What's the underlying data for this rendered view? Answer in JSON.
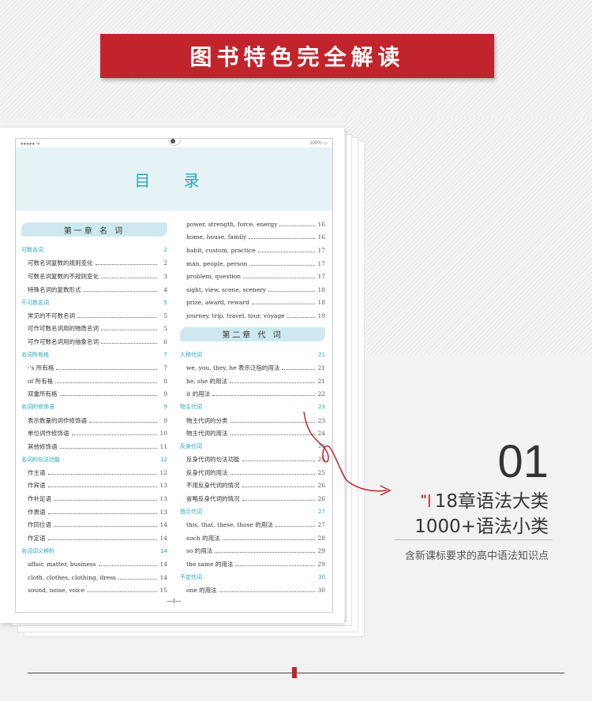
{
  "banner": {
    "title": "图书特色完全解读"
  },
  "tablet": {
    "status_left": "●●●●● ᯤ",
    "status_right": "100% ▭",
    "toc_title": "目 录",
    "page_number": "—I—",
    "left_column": {
      "chapter": "第一章 名 词",
      "rows": [
        {
          "type": "section",
          "label": "可数名词",
          "page": "2"
        },
        {
          "type": "item",
          "label": "可数名词复数的规则变化",
          "page": "2"
        },
        {
          "type": "item",
          "label": "可数名词复数的不规则变化",
          "page": "3"
        },
        {
          "type": "item",
          "label": "特殊名词的复数形式",
          "page": "4"
        },
        {
          "type": "section",
          "label": "不可数名词",
          "page": "5"
        },
        {
          "type": "item",
          "label": "常见的不可数名词",
          "page": "5"
        },
        {
          "type": "item",
          "label": "可作可数名词用的物质名词",
          "page": "5"
        },
        {
          "type": "item",
          "label": "可作可数名词用的抽象名词",
          "page": "6"
        },
        {
          "type": "section",
          "label": "名词所有格",
          "page": "7"
        },
        {
          "type": "item",
          "label": "-'s 所有格",
          "page": "7"
        },
        {
          "type": "item",
          "label": "of 所有格",
          "page": "8"
        },
        {
          "type": "item",
          "label": "双重所有格",
          "page": "9"
        },
        {
          "type": "section",
          "label": "名词的修饰语",
          "page": "9"
        },
        {
          "type": "item",
          "label": "表示数量的词作修饰语",
          "page": "9"
        },
        {
          "type": "item",
          "label": "单位词作修饰语",
          "page": "10"
        },
        {
          "type": "item",
          "label": "其他修饰语",
          "page": "11"
        },
        {
          "type": "section",
          "label": "名词的句法功能",
          "page": "12"
        },
        {
          "type": "item",
          "label": "作主语",
          "page": "12"
        },
        {
          "type": "item",
          "label": "作宾语",
          "page": "13"
        },
        {
          "type": "item",
          "label": "作补足语",
          "page": "13"
        },
        {
          "type": "item",
          "label": "作表语",
          "page": "13"
        },
        {
          "type": "item",
          "label": "作同位语",
          "page": "14"
        },
        {
          "type": "item",
          "label": "作定语",
          "page": "14"
        },
        {
          "type": "section",
          "label": "名词词义辨析",
          "page": "14"
        },
        {
          "type": "item",
          "label": "affair, matter, business",
          "page": "14"
        },
        {
          "type": "item",
          "label": "cloth, clothes, clothing, dress",
          "page": "14"
        },
        {
          "type": "item",
          "label": "sound, noise, voice",
          "page": "15"
        }
      ]
    },
    "right_column": {
      "rows_before": [
        {
          "type": "item",
          "label": "power, strength, force, energy",
          "page": "16"
        },
        {
          "type": "item",
          "label": "home, house, family",
          "page": "16"
        },
        {
          "type": "item",
          "label": "habit, custom, practice",
          "page": "17"
        },
        {
          "type": "item",
          "label": "man, people, person",
          "page": "17"
        },
        {
          "type": "item",
          "label": "problem, question",
          "page": "17"
        },
        {
          "type": "item",
          "label": "sight, view, scene, scenery",
          "page": "18"
        },
        {
          "type": "item",
          "label": "prize, award, reward",
          "page": "18"
        },
        {
          "type": "item",
          "label": "journey, trip, travel, tour, voyage",
          "page": "19"
        }
      ],
      "chapter": "第二章 代 词",
      "rows": [
        {
          "type": "section",
          "label": "人称代词",
          "page": "21"
        },
        {
          "type": "item",
          "label": "we, you, they, he 表示泛指的用法",
          "page": "21"
        },
        {
          "type": "item",
          "label": "he, she 的用法",
          "page": "21"
        },
        {
          "type": "item",
          "label": "it 的用法",
          "page": "22"
        },
        {
          "type": "section",
          "label": "物主代词",
          "page": "23"
        },
        {
          "type": "item",
          "label": "物主代词的分类",
          "page": "23"
        },
        {
          "type": "item",
          "label": "物主代词的用法",
          "page": "24"
        },
        {
          "type": "section",
          "label": "反身代词",
          "page": "25"
        },
        {
          "type": "item",
          "label": "反身代词的句法功能",
          "page": "25"
        },
        {
          "type": "item",
          "label": "反身代词的用法",
          "page": "25"
        },
        {
          "type": "item",
          "label": "不用反身代词的情况",
          "page": "26"
        },
        {
          "type": "item",
          "label": "省略反身代词的情况",
          "page": "26"
        },
        {
          "type": "section",
          "label": "指示代词",
          "page": "27"
        },
        {
          "type": "item",
          "label": "this, that, these, those 的用法",
          "page": "27"
        },
        {
          "type": "item",
          "label": "such 的用法",
          "page": "28"
        },
        {
          "type": "item",
          "label": "so 的用法",
          "page": "29"
        },
        {
          "type": "item",
          "label": "the same 的用法",
          "page": "29"
        },
        {
          "type": "section",
          "label": "不定代词",
          "page": "30"
        },
        {
          "type": "item",
          "label": "one 的用法",
          "page": "30"
        }
      ]
    }
  },
  "feature": {
    "number": "01",
    "mark": "\"|",
    "line1": "18章语法大类",
    "line2": "1000+语法小类",
    "line3": "含新课标要求的高中语法知识点"
  },
  "colors": {
    "accent": "#c1252b",
    "teal": "#2aa5b8",
    "chapter_bg": "#cde9ef"
  }
}
